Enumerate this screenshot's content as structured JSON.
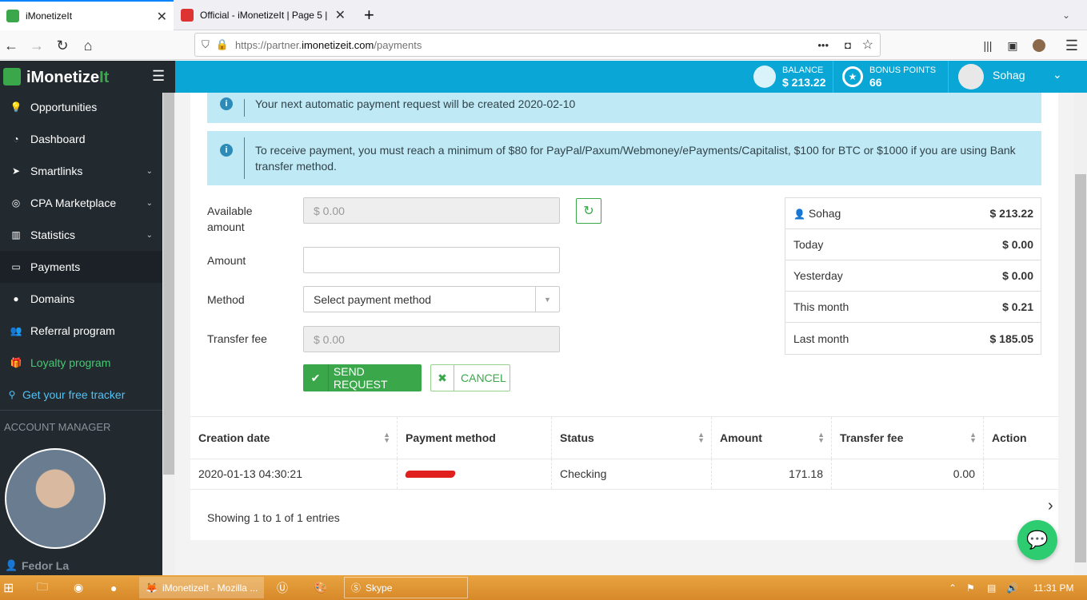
{
  "browser": {
    "tabs": [
      {
        "title": "iMonetizeIt",
        "active": true
      },
      {
        "title": "Official - iMonetizeIt | Page 5 | ",
        "active": false
      }
    ],
    "new_tab": "+",
    "url_prefix": "https://partner.",
    "url_domain": "imonetizeit.com",
    "url_path": "/payments"
  },
  "header": {
    "logo_text": "iMonetize",
    "logo_accent": "It",
    "balance_label": "BALANCE",
    "balance_value": "$ 213.22",
    "bonus_label": "BONUS POINTS",
    "bonus_value": "66",
    "user_name": "Sohag"
  },
  "sidebar": {
    "items": [
      {
        "label": "Opportunities",
        "icon": "lightbulb-icon"
      },
      {
        "label": "Dashboard",
        "icon": "dashboard-icon"
      },
      {
        "label": "Smartlinks",
        "icon": "paper-plane-icon",
        "expandable": true
      },
      {
        "label": "CPA Marketplace",
        "icon": "bullseye-icon",
        "expandable": true
      },
      {
        "label": "Statistics",
        "icon": "bar-chart-icon",
        "expandable": true
      },
      {
        "label": "Payments",
        "icon": "money-icon",
        "active": true
      },
      {
        "label": "Domains",
        "icon": "globe-icon"
      },
      {
        "label": "Referral program",
        "icon": "users-icon"
      },
      {
        "label": "Loyalty program",
        "icon": "gift-icon"
      }
    ],
    "tracker_link": "Get your free tracker",
    "account_manager_title": "ACCOUNT MANAGER",
    "manager_name": "Fedor La"
  },
  "alerts": {
    "next_payment": "Your next automatic payment request will be created 2020-02-10",
    "minimum": "To receive payment, you must reach a minimum of $80 for PayPal/Paxum/Webmoney/ePayments/Capitalist, $100 for BTC or $1000 if you are using Bank transfer method."
  },
  "form": {
    "available_label": "Available amount",
    "available_value": "$ 0.00",
    "amount_label": "Amount",
    "amount_value": "",
    "method_label": "Method",
    "method_placeholder": "Select payment method",
    "fee_label": "Transfer fee",
    "fee_value": "$ 0.00",
    "send_button": "SEND REQUEST",
    "cancel_button": "CANCEL"
  },
  "summary": {
    "rows": [
      {
        "label": "Sohag",
        "value": "$ 213.22"
      },
      {
        "label": "Today",
        "value": "$ 0.00"
      },
      {
        "label": "Yesterday",
        "value": "$ 0.00"
      },
      {
        "label": "This month",
        "value": "$ 0.21"
      },
      {
        "label": "Last month",
        "value": "$ 185.05"
      }
    ]
  },
  "table": {
    "headers": [
      "Creation date",
      "Payment method",
      "Status",
      "Amount",
      "Transfer fee",
      "Action"
    ],
    "rows": [
      {
        "date": "2020-01-13 04:30:21",
        "method": "",
        "status": "Checking",
        "amount": "171.18",
        "fee": "0.00",
        "action": ""
      }
    ],
    "footer": "Showing 1 to 1 of 1 entries"
  },
  "taskbar": {
    "firefox_label": "iMonetizeIt - Mozilla ...",
    "skype_label": "Skype",
    "clock": "11:31 PM"
  }
}
